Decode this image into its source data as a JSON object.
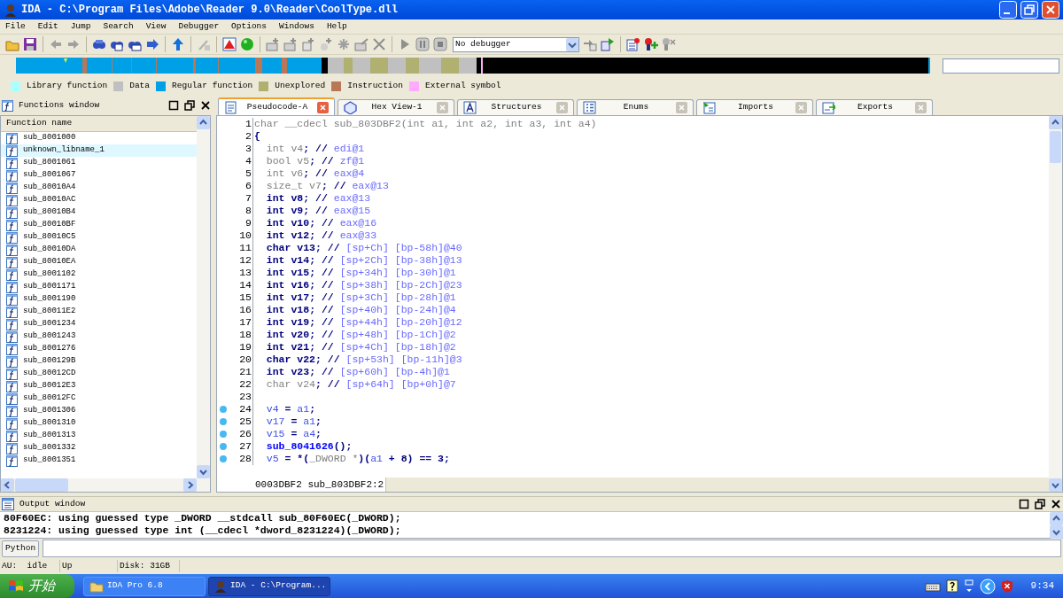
{
  "window": {
    "title": "IDA - C:\\Program Files\\Adobe\\Reader 9.0\\Reader\\CoolType.dll"
  },
  "menu": [
    "File",
    "Edit",
    "Jump",
    "Search",
    "View",
    "Debugger",
    "Options",
    "Windows",
    "Help"
  ],
  "debugger_select": {
    "value": "No debugger"
  },
  "legend": [
    {
      "label": "Library function",
      "color": "#aaffff"
    },
    {
      "label": "Data",
      "color": "#c0c0c0"
    },
    {
      "label": "Regular function",
      "color": "#00a0e6"
    },
    {
      "label": "Unexplored",
      "color": "#b0b070"
    },
    {
      "label": "Instruction",
      "color": "#b87858"
    },
    {
      "label": "External symbol",
      "color": "#ffaaff"
    }
  ],
  "functions_window": {
    "title": "Functions window",
    "column": "Function name",
    "items": [
      {
        "name": "sub_8001000",
        "selected": false
      },
      {
        "name": "unknown_libname_1",
        "selected": true
      },
      {
        "name": "sub_8001061",
        "selected": false
      },
      {
        "name": "sub_8001067",
        "selected": false
      },
      {
        "name": "sub_80010A4",
        "selected": false
      },
      {
        "name": "sub_80010AC",
        "selected": false
      },
      {
        "name": "sub_80010B4",
        "selected": false
      },
      {
        "name": "sub_80010BF",
        "selected": false
      },
      {
        "name": "sub_80010C5",
        "selected": false
      },
      {
        "name": "sub_80010DA",
        "selected": false
      },
      {
        "name": "sub_80010EA",
        "selected": false
      },
      {
        "name": "sub_8001102",
        "selected": false
      },
      {
        "name": "sub_8001171",
        "selected": false
      },
      {
        "name": "sub_8001190",
        "selected": false
      },
      {
        "name": "sub_80011E2",
        "selected": false
      },
      {
        "name": "sub_8001234",
        "selected": false
      },
      {
        "name": "sub_8001243",
        "selected": false
      },
      {
        "name": "sub_8001276",
        "selected": false
      },
      {
        "name": "sub_800129B",
        "selected": false
      },
      {
        "name": "sub_80012CD",
        "selected": false
      },
      {
        "name": "sub_80012E3",
        "selected": false
      },
      {
        "name": "sub_80012FC",
        "selected": false
      },
      {
        "name": "sub_8001306",
        "selected": false
      },
      {
        "name": "sub_8001310",
        "selected": false
      },
      {
        "name": "sub_8001313",
        "selected": false
      },
      {
        "name": "sub_8001332",
        "selected": false
      },
      {
        "name": "sub_8001351",
        "selected": false
      }
    ]
  },
  "tabs": [
    {
      "label": "Pseudocode-A",
      "selected": true
    },
    {
      "label": "Hex View-1",
      "selected": false
    },
    {
      "label": "Structures",
      "selected": false
    },
    {
      "label": "Enums",
      "selected": false
    },
    {
      "label": "Imports",
      "selected": false
    },
    {
      "label": "Exports",
      "selected": false
    }
  ],
  "code": {
    "lines": [
      {
        "number": "1",
        "breakpoint": false,
        "segments": [
          {
            "kind": "unused",
            "text": "char __cdecl sub_803DBF2(int a1, int a2, int a3, int a4)"
          }
        ]
      },
      {
        "number": "2",
        "breakpoint": false,
        "segments": [
          {
            "kind": "punct",
            "text": "{"
          }
        ]
      },
      {
        "number": "3",
        "breakpoint": false,
        "segments": [
          {
            "kind": "unused",
            "text": "  int v4"
          },
          {
            "kind": "punct",
            "text": "; //"
          },
          {
            "kind": "comment",
            "text": " edi@1"
          }
        ]
      },
      {
        "number": "4",
        "breakpoint": false,
        "segments": [
          {
            "kind": "unused",
            "text": "  bool v5"
          },
          {
            "kind": "punct",
            "text": "; //"
          },
          {
            "kind": "comment",
            "text": " zf@1"
          }
        ]
      },
      {
        "number": "5",
        "breakpoint": false,
        "segments": [
          {
            "kind": "unused",
            "text": "  int v6"
          },
          {
            "kind": "punct",
            "text": "; //"
          },
          {
            "kind": "comment",
            "text": " eax@4"
          }
        ]
      },
      {
        "number": "6",
        "breakpoint": false,
        "segments": [
          {
            "kind": "unused",
            "text": "  size_t v7"
          },
          {
            "kind": "punct",
            "text": "; //"
          },
          {
            "kind": "comment",
            "text": " eax@13"
          }
        ]
      },
      {
        "number": "7",
        "breakpoint": false,
        "segments": [
          {
            "kind": "decl",
            "text": "  int v8"
          },
          {
            "kind": "punct",
            "text": "; //"
          },
          {
            "kind": "comment",
            "text": " eax@13"
          }
        ]
      },
      {
        "number": "8",
        "breakpoint": false,
        "segments": [
          {
            "kind": "decl",
            "text": "  int v9"
          },
          {
            "kind": "punct",
            "text": "; //"
          },
          {
            "kind": "comment",
            "text": " eax@15"
          }
        ]
      },
      {
        "number": "9",
        "breakpoint": false,
        "segments": [
          {
            "kind": "decl",
            "text": "  int v10"
          },
          {
            "kind": "punct",
            "text": "; //"
          },
          {
            "kind": "comment",
            "text": " eax@16"
          }
        ]
      },
      {
        "number": "10",
        "breakpoint": false,
        "segments": [
          {
            "kind": "decl",
            "text": "  int v12"
          },
          {
            "kind": "punct",
            "text": "; //"
          },
          {
            "kind": "comment",
            "text": " eax@33"
          }
        ]
      },
      {
        "number": "11",
        "breakpoint": false,
        "segments": [
          {
            "kind": "decl",
            "text": "  char v13"
          },
          {
            "kind": "punct",
            "text": "; //"
          },
          {
            "kind": "comment",
            "text": " [sp+Ch] [bp-58h]@40"
          }
        ]
      },
      {
        "number": "12",
        "breakpoint": false,
        "segments": [
          {
            "kind": "decl",
            "text": "  int v14"
          },
          {
            "kind": "punct",
            "text": "; //"
          },
          {
            "kind": "comment",
            "text": " [sp+2Ch] [bp-38h]@13"
          }
        ]
      },
      {
        "number": "13",
        "breakpoint": false,
        "segments": [
          {
            "kind": "decl",
            "text": "  int v15"
          },
          {
            "kind": "punct",
            "text": "; //"
          },
          {
            "kind": "comment",
            "text": " [sp+34h] [bp-30h]@1"
          }
        ]
      },
      {
        "number": "14",
        "breakpoint": false,
        "segments": [
          {
            "kind": "decl",
            "text": "  int v16"
          },
          {
            "kind": "punct",
            "text": "; //"
          },
          {
            "kind": "comment",
            "text": " [sp+38h] [bp-2Ch]@23"
          }
        ]
      },
      {
        "number": "15",
        "breakpoint": false,
        "segments": [
          {
            "kind": "decl",
            "text": "  int v17"
          },
          {
            "kind": "punct",
            "text": "; //"
          },
          {
            "kind": "comment",
            "text": " [sp+3Ch] [bp-28h]@1"
          }
        ]
      },
      {
        "number": "16",
        "breakpoint": false,
        "segments": [
          {
            "kind": "decl",
            "text": "  int v18"
          },
          {
            "kind": "punct",
            "text": "; //"
          },
          {
            "kind": "comment",
            "text": " [sp+40h] [bp-24h]@4"
          }
        ]
      },
      {
        "number": "17",
        "breakpoint": false,
        "segments": [
          {
            "kind": "decl",
            "text": "  int v19"
          },
          {
            "kind": "punct",
            "text": "; //"
          },
          {
            "kind": "comment",
            "text": " [sp+44h] [bp-20h]@12"
          }
        ]
      },
      {
        "number": "18",
        "breakpoint": false,
        "segments": [
          {
            "kind": "decl",
            "text": "  int v20"
          },
          {
            "kind": "punct",
            "text": "; //"
          },
          {
            "kind": "comment",
            "text": " [sp+48h] [bp-1Ch]@2"
          }
        ]
      },
      {
        "number": "19",
        "breakpoint": false,
        "segments": [
          {
            "kind": "decl",
            "text": "  int v21"
          },
          {
            "kind": "punct",
            "text": "; //"
          },
          {
            "kind": "comment",
            "text": " [sp+4Ch] [bp-18h]@2"
          }
        ]
      },
      {
        "number": "20",
        "breakpoint": false,
        "segments": [
          {
            "kind": "decl",
            "text": "  char v22"
          },
          {
            "kind": "punct",
            "text": "; //"
          },
          {
            "kind": "comment",
            "text": " [sp+53h] [bp-11h]@3"
          }
        ]
      },
      {
        "number": "21",
        "breakpoint": false,
        "segments": [
          {
            "kind": "decl",
            "text": "  int v23"
          },
          {
            "kind": "punct",
            "text": "; //"
          },
          {
            "kind": "comment",
            "text": " [sp+60h] [bp-4h]@1"
          }
        ]
      },
      {
        "number": "22",
        "breakpoint": false,
        "segments": [
          {
            "kind": "unused",
            "text": "  char v24"
          },
          {
            "kind": "punct",
            "text": "; //"
          },
          {
            "kind": "comment",
            "text": " [sp+64h] [bp+0h]@7"
          }
        ]
      },
      {
        "number": "23",
        "breakpoint": false
      },
      {
        "number": "24",
        "breakpoint": true,
        "segments": [
          {
            "kind": "name",
            "text": "  v4"
          },
          {
            "kind": "punct",
            "text": " = "
          },
          {
            "kind": "name",
            "text": "a1"
          },
          {
            "kind": "punct",
            "text": ";"
          }
        ]
      },
      {
        "number": "25",
        "breakpoint": true,
        "segments": [
          {
            "kind": "name",
            "text": "  v17"
          },
          {
            "kind": "punct",
            "text": " = "
          },
          {
            "kind": "name",
            "text": "a1"
          },
          {
            "kind": "punct",
            "text": ";"
          }
        ]
      },
      {
        "number": "26",
        "breakpoint": true,
        "segments": [
          {
            "kind": "name",
            "text": "  v15"
          },
          {
            "kind": "punct",
            "text": " = "
          },
          {
            "kind": "name",
            "text": "a4"
          },
          {
            "kind": "punct",
            "text": ";"
          }
        ]
      },
      {
        "number": "27",
        "breakpoint": true,
        "segments": [
          {
            "kind": "call",
            "text": "  sub_8041626"
          },
          {
            "kind": "punct",
            "text": "();"
          }
        ]
      },
      {
        "number": "28",
        "breakpoint": true,
        "segments": [
          {
            "kind": "name",
            "text": "  v5"
          },
          {
            "kind": "punct",
            "text": " = *("
          },
          {
            "kind": "unused",
            "text": "_DWORD *"
          },
          {
            "kind": "punct",
            "text": ")("
          },
          {
            "kind": "name",
            "text": "a1"
          },
          {
            "kind": "punct",
            "text": " + 8) == 3;"
          }
        ]
      }
    ],
    "status": "0003DBF2 sub_803DBF2:2"
  },
  "output_window": {
    "title": "Output window",
    "lines": [
      "80F60EC: using guessed type _DWORD __stdcall sub_80F60EC(_DWORD);",
      "8231224: using guessed type int (__cdecl *dword_8231224)(_DWORD);"
    ]
  },
  "python_button": "Python",
  "status_bar": [
    "AU:  idle",
    "Up",
    "Disk: 31GB"
  ],
  "taskbar": {
    "start": "开始",
    "tasks": [
      {
        "label": "IDA Pro 6.8",
        "selected": false
      },
      {
        "label": "IDA - C:\\Program...",
        "selected": true
      }
    ],
    "clock": "9:34"
  }
}
